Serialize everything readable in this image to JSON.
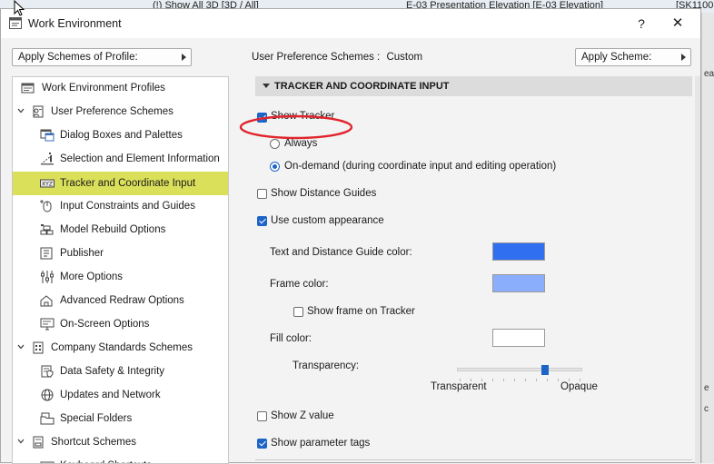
{
  "background": {
    "tab1": "(!) Show All 3D [3D / All]",
    "tab2": "E-03 Presentation Elevation [E-03 Elevation]",
    "tab3": "[SK1100",
    "right_fragments": [
      "ea",
      "e",
      "c"
    ]
  },
  "dialog": {
    "title": "Work Environment",
    "help_label": "?",
    "close_label": "✕"
  },
  "toolbar": {
    "apply_profile_label": "Apply Schemes of Profile:",
    "scheme_label": "User Preference Schemes :",
    "scheme_value": "Custom",
    "apply_scheme_label": "Apply Scheme:"
  },
  "tree": {
    "items": [
      {
        "label": "Work Environment Profiles",
        "icon": "profiles-icon"
      },
      {
        "label": "User Preference Schemes",
        "icon": "user-scheme-icon"
      },
      {
        "label": "Dialog Boxes and Palettes",
        "icon": "dialog-palettes-icon"
      },
      {
        "label": "Selection and Element Information",
        "icon": "selection-info-icon"
      },
      {
        "label": "Tracker and Coordinate Input",
        "icon": "xyz-tracker-icon"
      },
      {
        "label": "Input Constraints and Guides",
        "icon": "mouse-constraints-icon"
      },
      {
        "label": "Model Rebuild Options",
        "icon": "bricks-icon"
      },
      {
        "label": "Publisher",
        "icon": "publisher-icon"
      },
      {
        "label": "More Options",
        "icon": "sliders-icon"
      },
      {
        "label": "Advanced Redraw Options",
        "icon": "redraw-icon"
      },
      {
        "label": "On-Screen Options",
        "icon": "onscreen-icon"
      },
      {
        "label": "Company Standards Schemes",
        "icon": "company-scheme-icon"
      },
      {
        "label": "Data Safety & Integrity",
        "icon": "data-safety-icon"
      },
      {
        "label": "Updates and Network",
        "icon": "globe-icon"
      },
      {
        "label": "Special Folders",
        "icon": "folder-icon"
      },
      {
        "label": "Shortcut Schemes",
        "icon": "shortcut-scheme-icon"
      },
      {
        "label": "Keyboard Shortcuts",
        "icon": "keyboard-icon"
      }
    ]
  },
  "panel": {
    "header": "TRACKER AND COORDINATE INPUT",
    "show_tracker": {
      "label": "Show Tracker",
      "checked": true
    },
    "radio_always": {
      "label": "Always",
      "selected": false
    },
    "radio_on_demand": {
      "label": "On-demand (during coordinate input and editing operation)",
      "selected": true
    },
    "show_distance_guides": {
      "label": "Show Distance Guides",
      "checked": false
    },
    "use_custom_appearance": {
      "label": "Use custom appearance",
      "checked": true
    },
    "text_guide_color": {
      "label": "Text and Distance Guide color:",
      "color": "#2f6ff0"
    },
    "frame_color": {
      "label": "Frame color:",
      "color": "#8aaefc"
    },
    "show_frame_on_tracker": {
      "label": "Show frame on Tracker",
      "checked": false
    },
    "fill_color": {
      "label": "Fill color:",
      "color": "#ffffff"
    },
    "transparency": {
      "label": "Transparency:",
      "min_label": "Transparent",
      "max_label": "Opaque",
      "value": 0.7
    },
    "show_z_value": {
      "label": "Show Z value",
      "checked": false
    },
    "show_parameter_tags": {
      "label": "Show parameter tags",
      "checked": true
    }
  },
  "colors": {
    "selected_highlight": "#dbe05a",
    "accent": "#1c64c8",
    "annotation_circle": "#e0242b"
  }
}
